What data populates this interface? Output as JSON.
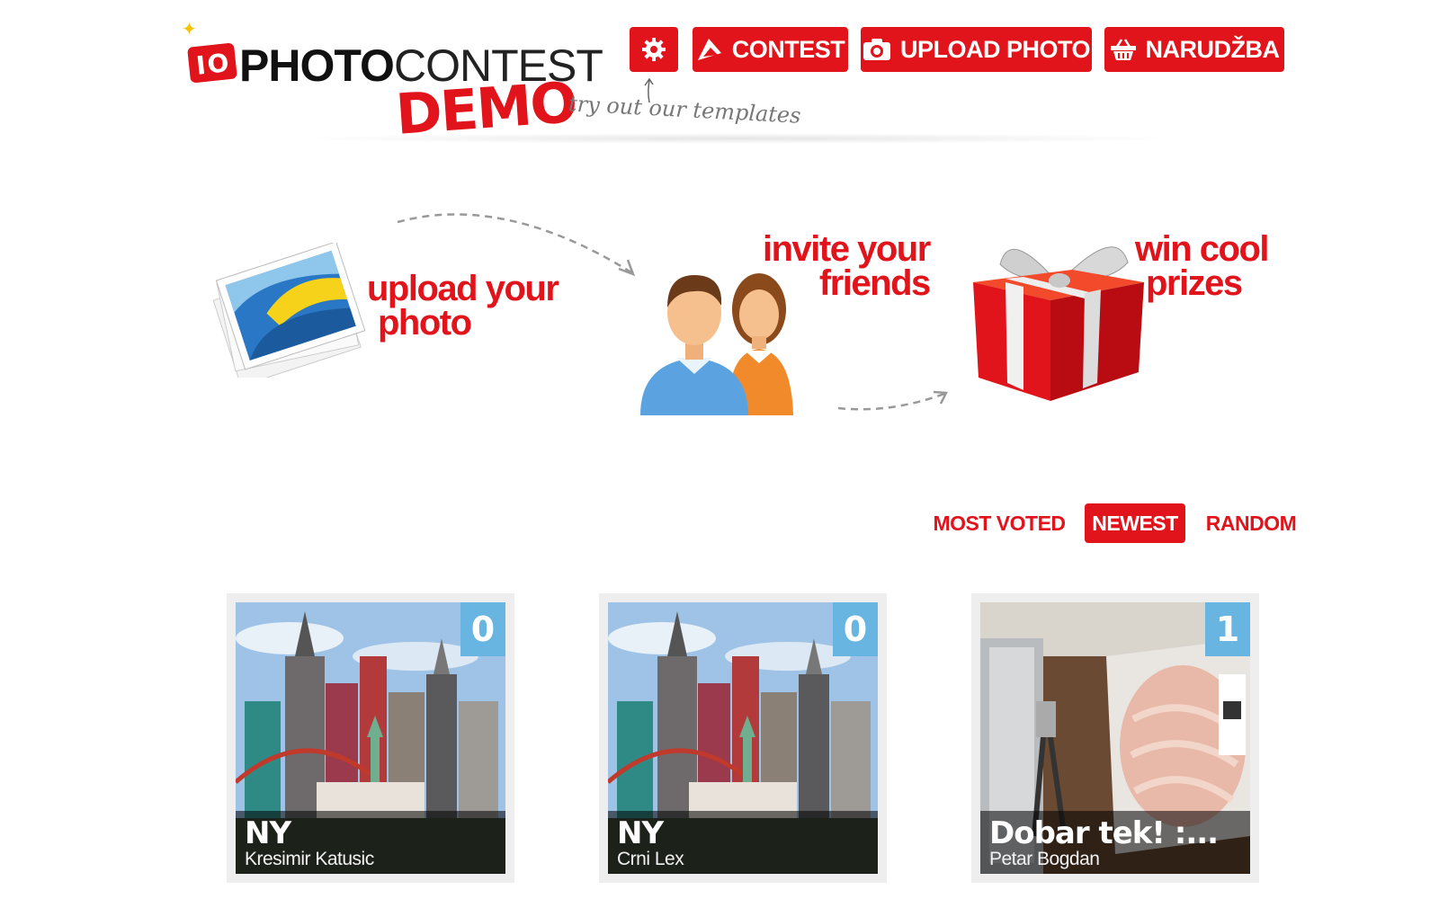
{
  "header": {
    "logo": {
      "mark": "IO",
      "word_bold": "PHOTO",
      "word_light": "CONTEST",
      "demo": "DEMO"
    },
    "tagline": "try out our templates",
    "nav": {
      "settings_icon": "gear-icon",
      "contest": {
        "label": "CONTEST",
        "icon": "flag-icon"
      },
      "upload": {
        "label": "UPLOAD PHOTO",
        "icon": "camera-icon"
      },
      "order": {
        "label": "NARUDŽBA",
        "icon": "basket-icon"
      }
    }
  },
  "steps": [
    {
      "line1": "upload your",
      "line2": "photo",
      "icon": "photo-stack-icon"
    },
    {
      "line1": "invite your",
      "line2": "friends",
      "icon": "people-icon"
    },
    {
      "line1": "win cool",
      "line2": "prizes",
      "icon": "gift-icon"
    }
  ],
  "sort": {
    "most_voted": "MOST VOTED",
    "newest": "NEWEST",
    "random": "RANDOM",
    "active": "newest"
  },
  "entries": [
    {
      "title": "NY",
      "author": "Kresimir Katusic",
      "votes": "0"
    },
    {
      "title": "NY",
      "author": "Crni Lex",
      "votes": "0"
    },
    {
      "title": "Dobar tek! :...",
      "author": "Petar Bogdan",
      "votes": "1"
    }
  ],
  "colors": {
    "brand_red": "#e1131b",
    "vote_badge": "#67b5e0"
  }
}
